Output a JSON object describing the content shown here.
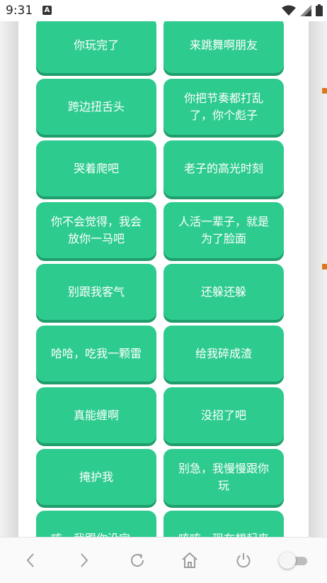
{
  "status_bar": {
    "time": "9:31",
    "notification_glyph": "A"
  },
  "grid_buttons": [
    "你玩完了",
    "来跳舞啊朋友",
    "跨边扭舌头",
    "你把节奏都打乱了，你个彪子",
    "哭着爬吧",
    "老子的高光时刻",
    "你不会觉得，我会放你一马吧",
    "人活一辈子，就是为了脸面",
    "别跟我客气",
    "还躲还躲",
    "哈哈，吃我一颗雷",
    "给我碎成渣",
    "真能缠啊",
    "没招了吧",
    "掩护我",
    "别急，我慢慢跟你玩",
    "咳，我跟你没完，",
    "咳咳，现在想起来"
  ],
  "nav_icons": [
    "back-icon",
    "forward-icon",
    "refresh-icon",
    "home-icon",
    "power-icon",
    "toggle-switch"
  ],
  "colors": {
    "button": "#2ecb8f",
    "button_shadow": "#1f9e6c",
    "accent_notch": "#d97a1a"
  }
}
